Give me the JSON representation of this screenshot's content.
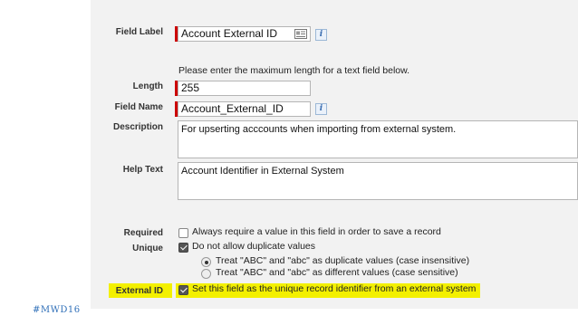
{
  "form": {
    "field_label": {
      "label": "Field Label",
      "value": "Account External ID"
    },
    "instructions": "Please enter the maximum length for a text field below.",
    "length": {
      "label": "Length",
      "value": "255"
    },
    "field_name": {
      "label": "Field Name",
      "value": "Account_External_ID"
    },
    "description": {
      "label": "Description",
      "value": "For upserting acccounts when importing from external system."
    },
    "help_text": {
      "label": "Help Text",
      "value": "Account Identifier in External System"
    },
    "required": {
      "label": "Required",
      "text": "Always require a value in this field in order to save a record",
      "checked": false
    },
    "unique": {
      "label": "Unique",
      "text": "Do not allow duplicate values",
      "checked": true,
      "options": [
        {
          "text": "Treat \"ABC\" and \"abc\" as duplicate values (case insensitive)",
          "selected": true
        },
        {
          "text": "Treat \"ABC\" and \"abc\" as different values (case sensitive)",
          "selected": false
        }
      ]
    },
    "external_id": {
      "label": "External ID",
      "text": "Set this field as the unique record identifier from an external system",
      "checked": true
    }
  },
  "hashtag": "#MWD16",
  "colors": {
    "required_bar": "#cc0000",
    "highlight": "#f3f000",
    "hashtag": "#2f6fb8",
    "panel_bg": "#f2f2f2"
  },
  "icons": {
    "info": "info-icon",
    "card": "card-icon"
  },
  "info_glyph": "i"
}
